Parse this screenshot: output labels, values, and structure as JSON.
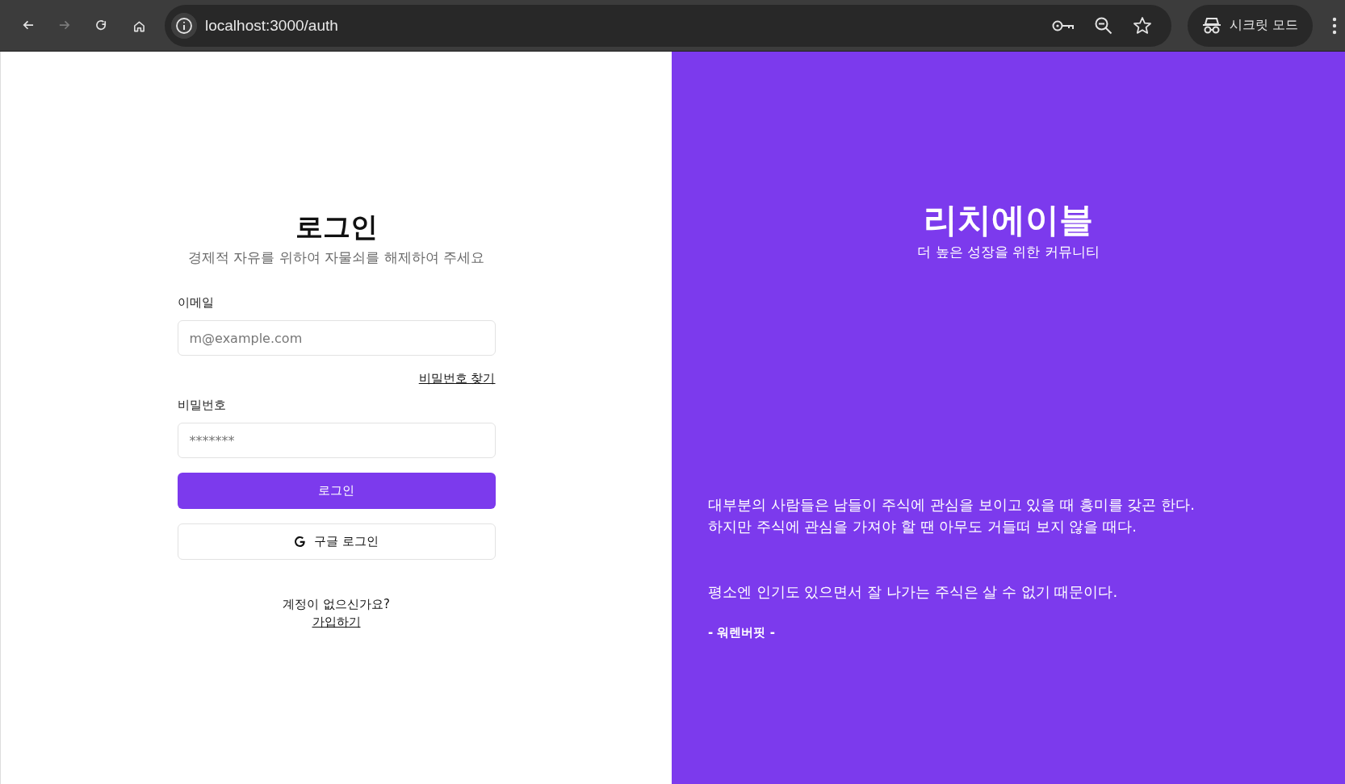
{
  "browser": {
    "nav": [
      {
        "kind": "back",
        "disabled": false
      },
      {
        "kind": "forward",
        "disabled": true
      },
      {
        "kind": "reload",
        "disabled": false
      },
      {
        "kind": "home",
        "disabled": false
      }
    ],
    "url": "localhost:3000/auth",
    "profile_label": "시크릿 모드"
  },
  "login": {
    "title": "로그인",
    "subtitle": "경제적 자유를 위하여 자물쇠를 해제하여 주세요",
    "fields": [
      {
        "label": "이메일",
        "placeholder": "m@example.com"
      },
      {
        "label": "비밀번호",
        "placeholder": "*******"
      }
    ],
    "forgot_link": "비밀번호 찾기",
    "buttons": [
      {
        "kind": "primary",
        "label": "로그인"
      },
      {
        "kind": "google",
        "label": "구글 로그인"
      }
    ],
    "signup_prompt": "계정이 없으신가요?",
    "signup_link": "가입하기"
  },
  "brand": {
    "title": "리치에이블",
    "tagline": "더 높은 성장을 위한 커뮤니티",
    "quote_lines": [
      "대부분의 사람들은 남들이 주식에 관심을 보이고 있을 때 흥미를 갖곤 한다.",
      "하지만 주식에 관심을 가져야 할 땐 아무도 거들떠 보지 않을 때다."
    ],
    "quote_conclusion": "평소엔 인기도 있으면서 잘 나가는 주식은 살 수 없기 때문이다.",
    "author": "- 워렌버핏 -"
  }
}
